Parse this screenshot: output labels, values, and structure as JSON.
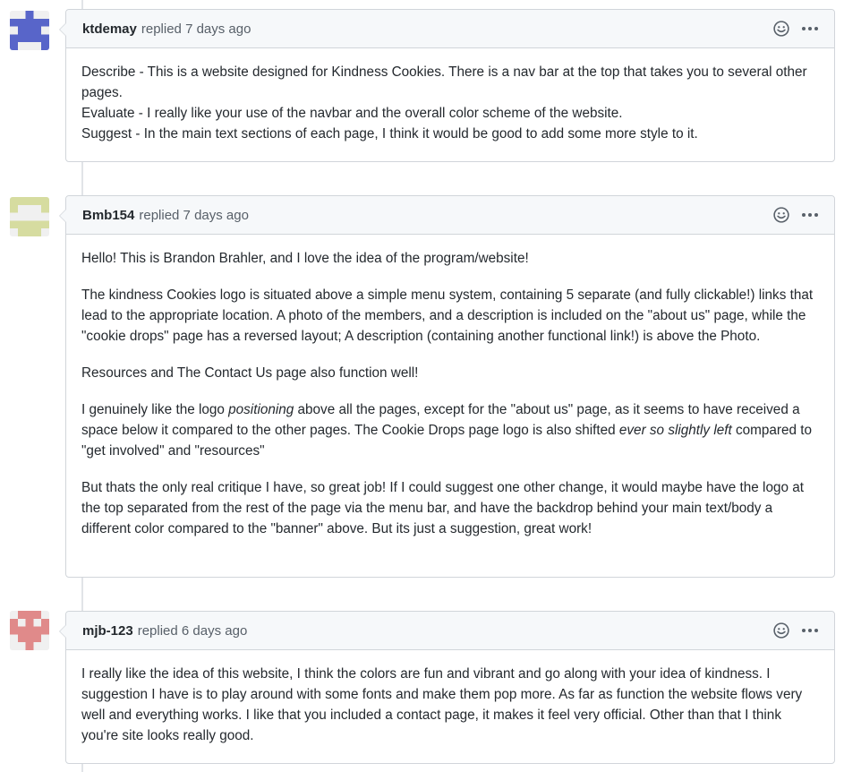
{
  "comments": [
    {
      "author": "ktdemay",
      "meta": "replied 7 days ago",
      "avatar_color": "#5865c9",
      "paragraphs": [
        {
          "lines": [
            "Describe - This is a website designed for Kindness Cookies. There is a nav bar at the top that takes you to several other pages.",
            "Evaluate - I really like your use of the navbar and the overall color scheme of the website.",
            "Suggest - In the main text sections of each page, I think it would be good to add some more style to it."
          ]
        }
      ]
    },
    {
      "author": "Bmb154",
      "meta": "replied 7 days ago",
      "avatar_color": "#d6dca0",
      "paragraphs": [
        {
          "parts": [
            "Hello! This is Brandon Brahler, and I love the idea of the program/website!"
          ]
        },
        {
          "parts": [
            "The kindness Cookies logo is situated above a simple menu system, containing 5 separate (and fully clickable!) links that lead to the appropriate location. A photo of the members, and a description is included on the \"about us\" page, while the \"cookie drops\" page has a reversed layout; A description (containing another functional link!) is above the Photo."
          ]
        },
        {
          "parts": [
            "Resources and The Contact Us page also function well!"
          ]
        },
        {
          "parts": [
            "I genuinely like the logo ",
            "positioning",
            " above all the pages, except for the \"about us\" page, as it seems to have received a space below it compared to the other pages. The Cookie Drops page logo is also shifted ",
            "ever so slightly left",
            " compared to \"get involved\" and \"resources\""
          ]
        },
        {
          "parts": [
            "But thats the only real critique I have, so great job! If I could suggest one other change, it would maybe have the logo at the top separated from the rest of the page via the menu bar, and have the backdrop behind your main text/body a different color compared to the \"banner\" above. But its just a suggestion, great work!"
          ]
        }
      ]
    },
    {
      "author": "mjb-123",
      "meta": "replied 6 days ago",
      "avatar_color": "#e08a8a",
      "paragraphs": [
        {
          "parts": [
            "I really like the idea of this website, I think the colors are fun and vibrant and go along with your idea of kindness. I suggestion I have is to play around with some fonts and make them pop more. As far as function the website flows very well and everything works. I like that you included a contact page, it makes it feel very official. Other than that I think you're site looks really good."
          ]
        }
      ]
    }
  ],
  "icons": {
    "reaction": "smiley-icon",
    "menu": "kebab-horizontal-icon"
  }
}
